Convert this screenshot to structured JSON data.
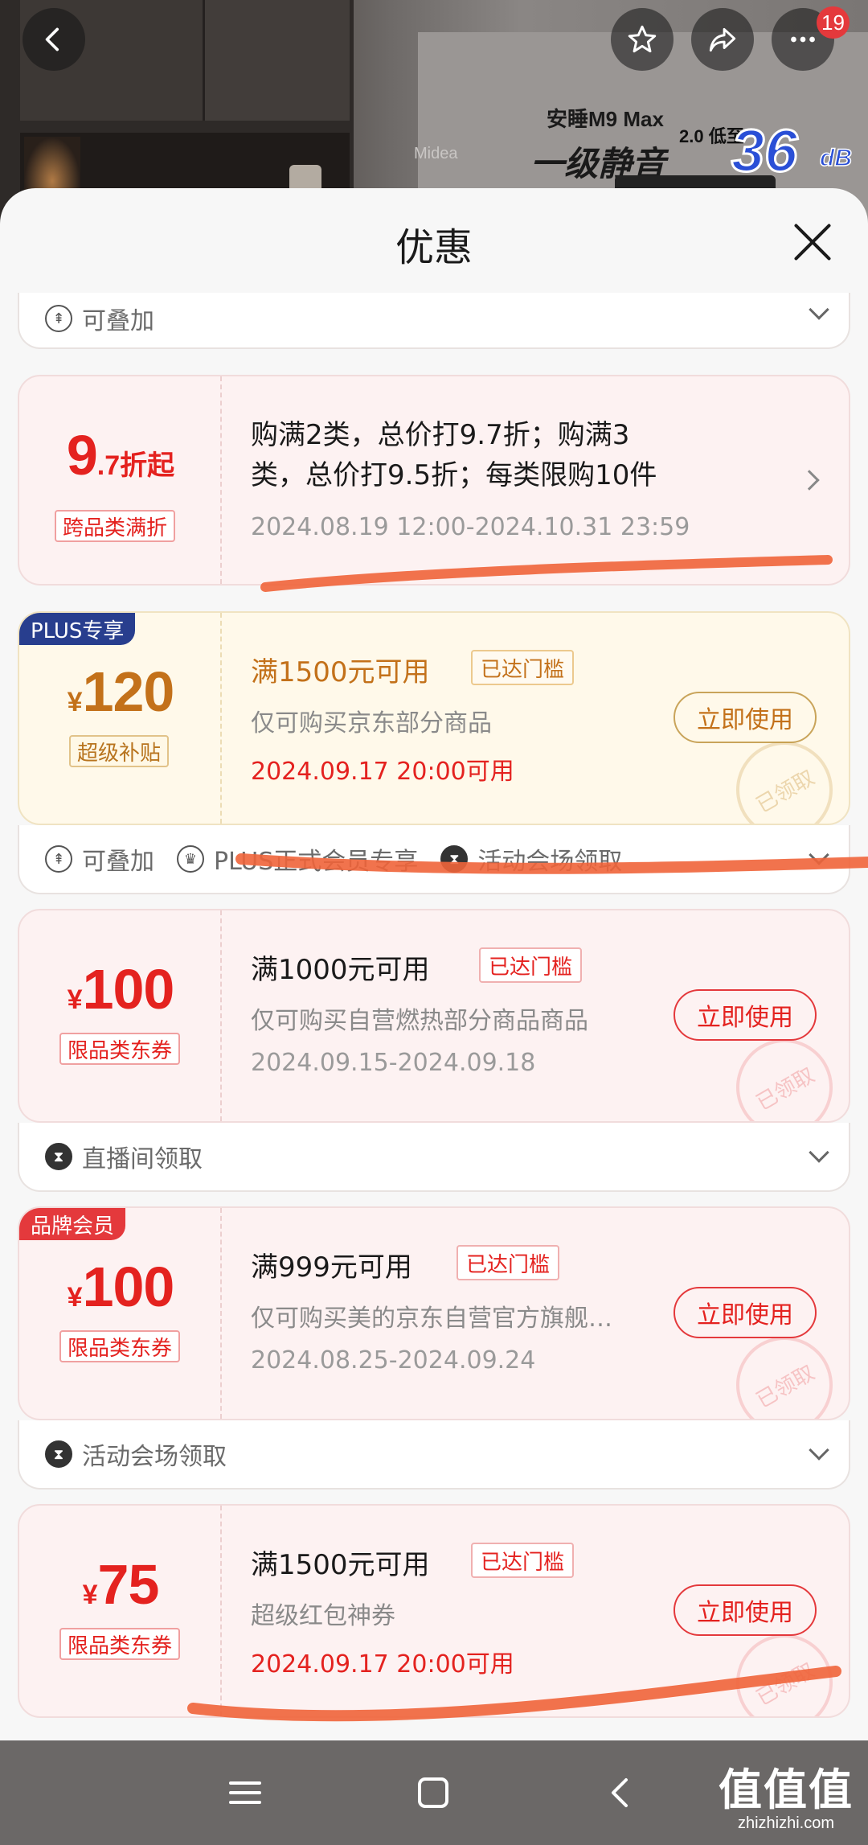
{
  "header": {
    "notification_count": "19",
    "backdrop_ad": {
      "brand_logo": "Midea",
      "title": "安睡M9 Max",
      "headline": "一级静音",
      "version_note": "2.0 低至",
      "decibels": "36",
      "unit": "dB"
    }
  },
  "sheet": {
    "title": "优惠"
  },
  "stackable_row": {
    "label": "可叠加"
  },
  "discount_card": {
    "amount_main": "9",
    "amount_sub": ".7折起",
    "tag": "跨品类满折",
    "rule_line1": "购满2类，总价打9.7折；购满3",
    "rule_line2": "类，总价打9.5折；每类限购10件",
    "validity": "2024.08.19 12:00-2024.10.31 23:59"
  },
  "coupons": [
    {
      "corner": "PLUS专享",
      "currency": "¥",
      "amount": "120",
      "tag": "超级补贴",
      "title": "满1500元可用",
      "status": "已达门槛",
      "desc": "仅可购买京东部分商品",
      "date": "2024.09.17 20:00可用",
      "button": "立即使用",
      "stamp": "已领取",
      "footer": [
        "可叠加",
        "PLUS正式会员专享",
        "活动会场领取"
      ]
    },
    {
      "currency": "¥",
      "amount": "100",
      "tag": "限品类东券",
      "title": "满1000元可用",
      "status": "已达门槛",
      "desc": "仅可购买自营燃热部分商品商品",
      "date": "2024.09.15-2024.09.18",
      "button": "立即使用",
      "stamp": "已领取",
      "footer": [
        "直播间领取"
      ]
    },
    {
      "corner": "品牌会员",
      "currency": "¥",
      "amount": "100",
      "tag": "限品类东券",
      "title": "满999元可用",
      "status": "已达门槛",
      "desc": "仅可购买美的京东自营官方旗舰…",
      "date": "2024.08.25-2024.09.24",
      "button": "立即使用",
      "stamp": "已领取",
      "footer": [
        "活动会场领取"
      ]
    },
    {
      "currency": "¥",
      "amount": "75",
      "tag": "限品类东券",
      "title": "满1500元可用",
      "status": "已达门槛",
      "desc": "超级红包神券",
      "date": "2024.09.17 20:00可用",
      "button": "立即使用",
      "stamp": "已领取"
    }
  ],
  "watermark": {
    "chars": "值值值",
    "domain": "zhizhizhi.com"
  },
  "colors": {
    "accent_red": "#e4221f",
    "gold": "#c3711a",
    "plus_blue": "#283e8e",
    "marker_orange": "#f0643a"
  }
}
